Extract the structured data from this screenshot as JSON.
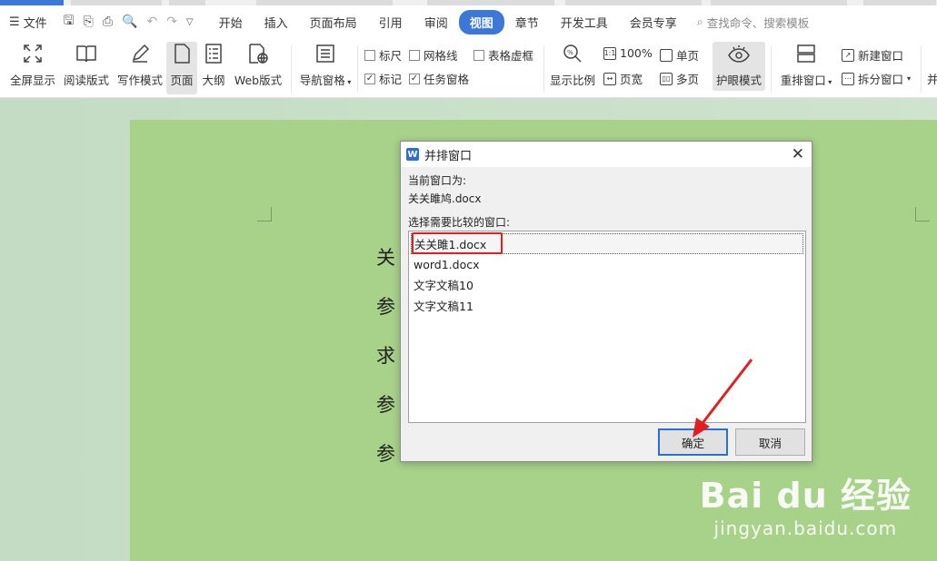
{
  "menu": {
    "file_label": "文件",
    "tabs": [
      {
        "label": "开始"
      },
      {
        "label": "插入"
      },
      {
        "label": "页面布局"
      },
      {
        "label": "引用"
      },
      {
        "label": "审阅"
      },
      {
        "label": "视图"
      },
      {
        "label": "章节"
      },
      {
        "label": "开发工具"
      },
      {
        "label": "会员专享"
      }
    ],
    "search_placeholder": "查找命令、搜索模板"
  },
  "ribbon": {
    "fullscreen": "全屏显示",
    "read_layout": "阅读版式",
    "write_mode": "写作模式",
    "page": "页面",
    "outline": "大纲",
    "web_layout": "Web版式",
    "nav_pane": "导航窗格",
    "ruler": "标尺",
    "gridlines": "网格线",
    "table_gridlines": "表格虚框",
    "marks": "标记",
    "task_pane": "任务窗格",
    "zoom_ratio": "显示比例",
    "zoom_100": "100%",
    "page_width": "页宽",
    "single_page": "单页",
    "multi_page": "多页",
    "eye_protect": "护眼模式",
    "arrange": "重排窗口",
    "new_window": "新建窗口",
    "split_window": "拆分窗口",
    "more": "并"
  },
  "document": {
    "lines": [
      "关",
      "参",
      "求",
      "参",
      "参"
    ]
  },
  "dialog": {
    "title": "并排窗口",
    "current_label": "当前窗口为:",
    "current_file": "关关雎鸠.docx",
    "select_label": "选择需要比较的窗口:",
    "items": [
      {
        "label": "关关雎1.docx",
        "selected": true
      },
      {
        "label": "word1.docx",
        "selected": false
      },
      {
        "label": "文字文稿10",
        "selected": false
      },
      {
        "label": "文字文稿11",
        "selected": false
      }
    ],
    "ok": "确定",
    "cancel": "取消"
  },
  "watermark": {
    "brand": "Bai du 经验",
    "url": "jingyan.baidu.com"
  },
  "colors": {
    "accent": "#3b78d8",
    "page_bg": "#a8d18a",
    "highlight_red": "#e02020"
  }
}
